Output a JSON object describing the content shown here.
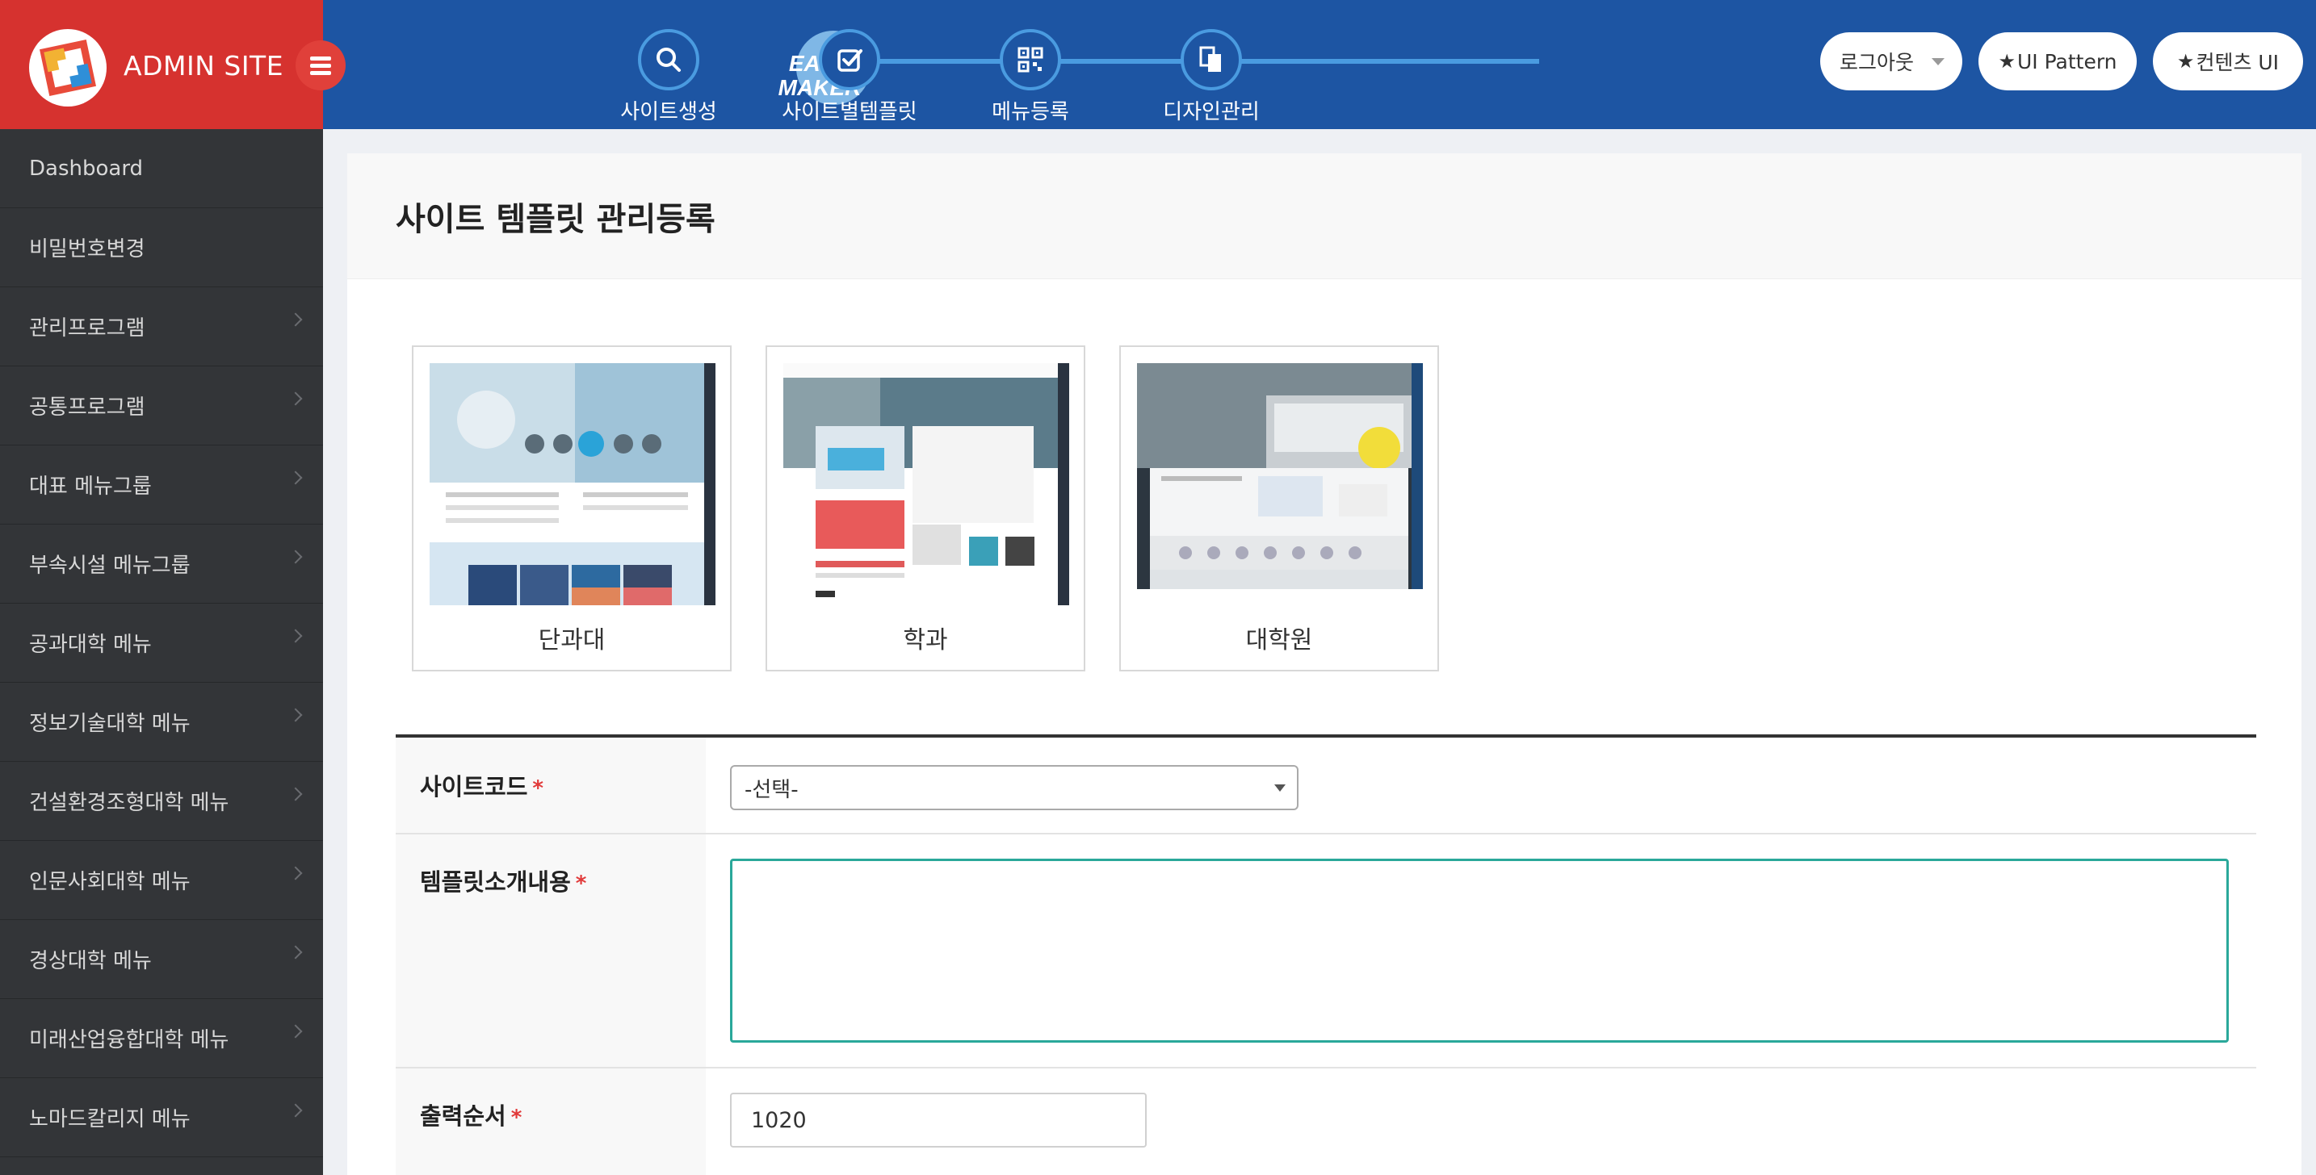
{
  "header": {
    "brand_title": "ADMIN SITE",
    "easy_maker_line1": "EASY",
    "easy_maker_line2": "MAKER",
    "steps": [
      {
        "label": "사이트생성",
        "icon": "search-icon"
      },
      {
        "label": "사이트별템플릿",
        "icon": "check-square-icon"
      },
      {
        "label": "메뉴등록",
        "icon": "qr-grid-icon"
      },
      {
        "label": "디자인관리",
        "icon": "documents-icon"
      }
    ],
    "logout_label": "로그아웃",
    "ui_pattern_label": "UI Pattern",
    "content_ui_label": "컨텐츠 UI",
    "star": "★"
  },
  "sidebar": {
    "items": [
      {
        "label": "Dashboard",
        "has_sub": false
      },
      {
        "label": "비밀번호변경",
        "has_sub": false
      },
      {
        "label": "관리프로그램",
        "has_sub": true
      },
      {
        "label": "공통프로그램",
        "has_sub": true
      },
      {
        "label": "대표 메뉴그룹",
        "has_sub": true
      },
      {
        "label": "부속시설 메뉴그룹",
        "has_sub": true
      },
      {
        "label": "공과대학 메뉴",
        "has_sub": true
      },
      {
        "label": "정보기술대학 메뉴",
        "has_sub": true
      },
      {
        "label": "건설환경조형대학 메뉴",
        "has_sub": true
      },
      {
        "label": "인문사회대학 메뉴",
        "has_sub": true
      },
      {
        "label": "경상대학 메뉴",
        "has_sub": true
      },
      {
        "label": "미래산업융합대학 메뉴",
        "has_sub": true
      },
      {
        "label": "노마드칼리지 메뉴",
        "has_sub": true
      }
    ]
  },
  "main": {
    "title": "사이트 템플릿 관리등록",
    "templates": [
      {
        "label": "단과대"
      },
      {
        "label": "학과"
      },
      {
        "label": "대학원"
      }
    ],
    "form": {
      "site_code_label": "사이트코드",
      "site_code_value": "-선택-",
      "template_desc_label": "템플릿소개내용",
      "template_desc_value": "",
      "order_label": "출력순서",
      "order_value": "1020",
      "required_mark": "*"
    }
  },
  "colors": {
    "brand_red": "#d6322f",
    "topbar_blue": "#1d55a3",
    "step_line_blue": "#4a9be0",
    "sidebar_dark": "#333538",
    "focus_teal": "#2aa89a",
    "required_red": "#e13a3a"
  }
}
